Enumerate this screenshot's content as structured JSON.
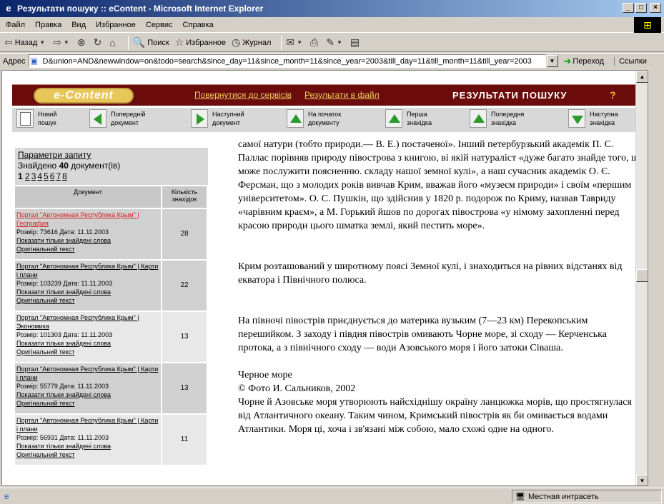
{
  "window": {
    "title": "Результати пошуку :: eContent - Microsoft Internet Explorer",
    "controls": {
      "minimize": "_",
      "maximize": "□",
      "close": "×"
    }
  },
  "menu": [
    "Файл",
    "Правка",
    "Вид",
    "Избранное",
    "Сервис",
    "Справка"
  ],
  "toolbar": {
    "back": "Назад",
    "search": "Поиск",
    "favorites": "Избранное",
    "history": "Журнал"
  },
  "address": {
    "label": "Адрес",
    "value": "D&union=AND&newwindow=on&todo=search&since_day=11&since_month=11&since_year=2003&till_day=11&till_month=11&till_year=2003",
    "go": "Переход",
    "links": "Ссылки"
  },
  "banner": {
    "logo": "e-Content",
    "back_link": "Повернутися до сервісів",
    "file_link": "Результати в файл",
    "title": "РЕЗУЛЬТАТИ ПОШУКУ",
    "help": "?"
  },
  "nav": [
    {
      "l1": "Новий",
      "l2": "пошук"
    },
    {
      "l1": "Попередній",
      "l2": "документ"
    },
    {
      "l1": "Наступний",
      "l2": "документ"
    },
    {
      "l1": "На початок",
      "l2": "документу"
    },
    {
      "l1": "Перша",
      "l2": "знахідка"
    },
    {
      "l1": "Попередня",
      "l2": "знахідка"
    },
    {
      "l1": "Наступна",
      "l2": "знахідка"
    }
  ],
  "params": {
    "link": "Параметри запиту",
    "found_prefix": "Знайдено",
    "found_count": "40",
    "found_suffix": "документ(ів)",
    "current_page": "1",
    "pages": [
      "2",
      "3",
      "4",
      "5",
      "6",
      "7",
      "8"
    ]
  },
  "results": {
    "col_doc": "Документ",
    "col_count": "Кількість знахідок",
    "size_label": "Розмір:",
    "date_label": "Дата:",
    "show_only": "Показати тільки знайдені слова",
    "original": "Оригінальний текст",
    "rows": [
      {
        "title": "Портал \"Автономная Республика Крым\" | География",
        "size": "73616",
        "date": "11.11.2003",
        "count": "28"
      },
      {
        "title": "Портал \"Автономная Республика Крым\" | Карти і плани",
        "size": "103239",
        "date": "11.11.2003",
        "count": "22"
      },
      {
        "title": "Портал \"Автономная Республика Крым\" | Экономика",
        "size": "101303",
        "date": "11.11.2003",
        "count": "13"
      },
      {
        "title": "Портал \"Автономная Республика Крым\" | Карти і плани",
        "size": "55779",
        "date": "11.11.2003",
        "count": "13"
      },
      {
        "title": "Портал \"Автономная Республика Крым\" | Карти і плани",
        "size": "56931",
        "date": "11.11.2003",
        "count": "11"
      }
    ]
  },
  "content": {
    "p1": "самої натури (тобто природи.— В. Е.) постаченої». Інший петербурзький академік П. С. Паллас порівняв природу півострова з книгою, ві якій натураліст «дуже багато знайде того, що може послужити поясненню. складу нашої земної кулі», а наш сучасник академік О. Є. Ферсман, що з молодих років вивчав Крим, вважав його «музеєм природи» і своїм «першим університетом». О. С. Пушкін, що здійснив у 1820 р. подорож по Криму, назвав Тавриду «чарівним краєм», а М. Горький йшов по дорогах півострова «у німому захопленні перед красою природи цього шматка землі, який пестить море».",
    "p2": "Крим розташований у широтному поясі Земної кулі, і знаходиться на рівних відстанях від екватора і Північного полюса.",
    "p3": "На півночі півострів приєднується до материка вузьким (7—23 км) Перекопським перешийком. З заходу і півдня півострів омивають Чорне море, зі сходу — Керченська протока, а з північного сходу — води Азовського моря і його затоки Сіваша.",
    "caption1": "Черное море",
    "caption2": "© Фото И. Сальников, 2002",
    "p4": "Чорне й Азовське моря утворюють найсхіднішу окраїну ланцюжка морів, що простягнулася від Атлантичного океану. Таким чином, Кримський півострів як би омивається водами Атлантики. Моря ці, хоча і зв'язані між собою, мало схожі одне на одного."
  },
  "status": {
    "zone": "Местная интрасеть"
  }
}
